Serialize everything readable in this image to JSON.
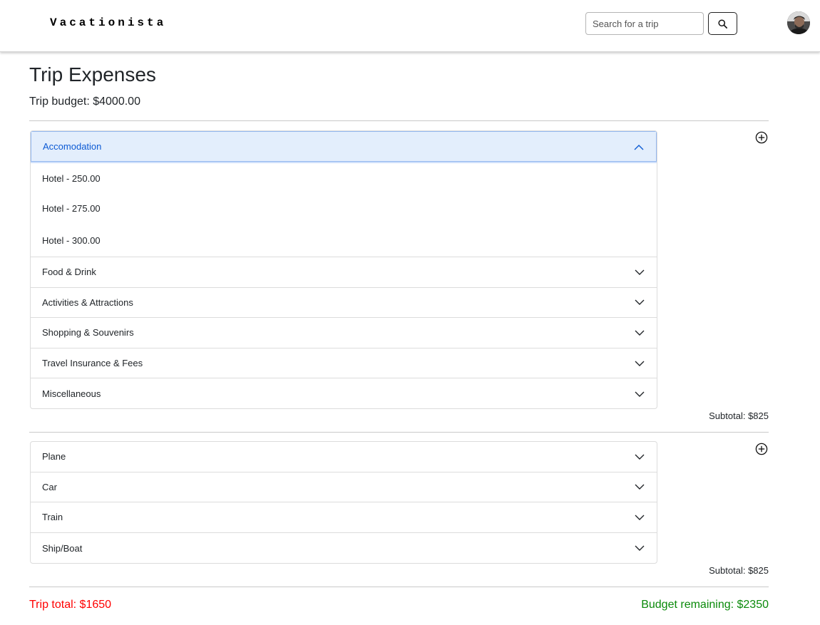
{
  "navbar": {
    "brand": "Vacationista",
    "search_placeholder": "Search for a trip",
    "search_value": ""
  },
  "page": {
    "title": "Trip Expenses",
    "budget": "Trip budget: $4000.00"
  },
  "expenses_section": {
    "open_category": {
      "label": "Accomodation",
      "items": [
        "Hotel - 250.00",
        "Hotel - 275.00",
        "Hotel - 300.00"
      ]
    },
    "categories": [
      "Food & Drink",
      "Activities & Attractions",
      "Shopping & Souvenirs",
      "Travel Insurance & Fees",
      "Miscellaneous"
    ],
    "subtotal": "Subtotal: $825"
  },
  "transport_section": {
    "categories": [
      "Plane",
      "Car",
      "Train",
      "Ship/Boat"
    ],
    "subtotal": "Subtotal: $825"
  },
  "footer": {
    "trip_total": "Trip total: $1650",
    "budget_remaining": "Budget remaining: $2350"
  },
  "colors": {
    "accent_blue": "#0c5ad4",
    "open_header_bg": "#e3eefc",
    "trip_total": "#ff0000",
    "budget_remaining": "#0a8a0a"
  },
  "icons": {
    "search": "search-icon",
    "add": "plus-circle-icon",
    "expand": "chevron-down-icon",
    "collapse": "chevron-up-icon"
  }
}
